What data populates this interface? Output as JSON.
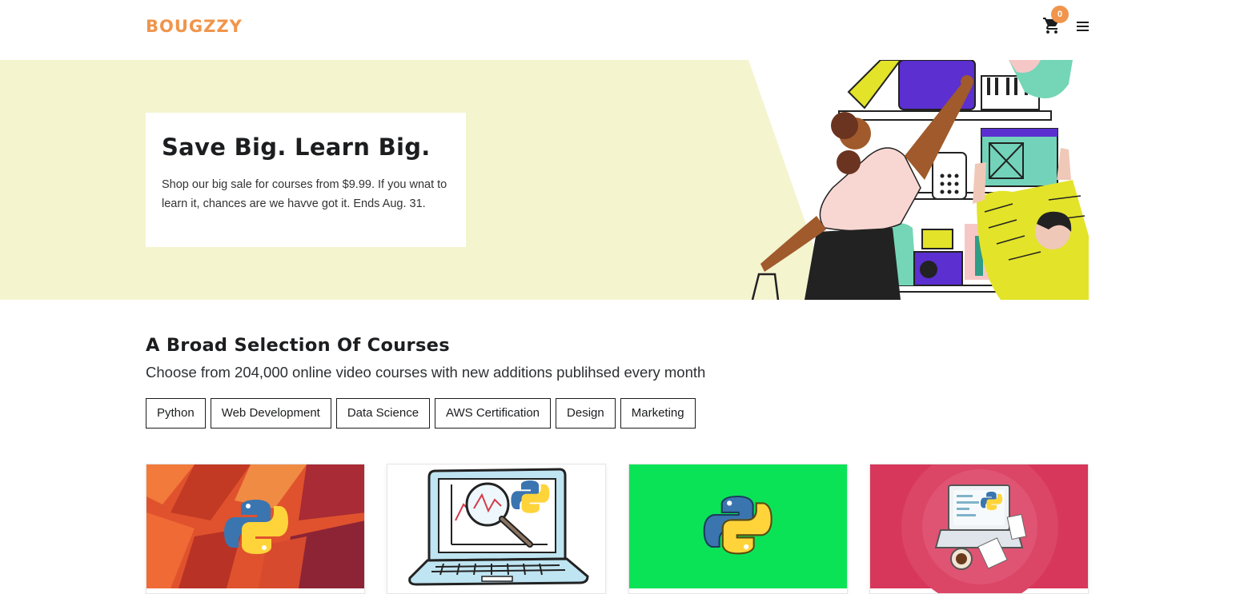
{
  "header": {
    "brand": "BOUGZZY",
    "cart_count": "0",
    "icons": [
      "cart-icon",
      "menu-icon"
    ]
  },
  "hero": {
    "title": "Save Big. Learn Big.",
    "text": "Shop our big sale for courses from $9.99. If you wnat to learn it, chances are we havve got it. Ends Aug. 31."
  },
  "section": {
    "title": "A Broad Selection Of Courses",
    "subtitle": "Choose from 204,000 online video courses with new additions publihsed every month",
    "tags": [
      "Python",
      "Web Development",
      "Data Science",
      "AWS Certification",
      "Design",
      "Marketing"
    ]
  },
  "colors": {
    "accent": "#f0954b",
    "hero_bg": "#f4f4cf",
    "card1_bg": "#e0522d",
    "card3_bg": "#0be357",
    "card4_bg": "#d7375a"
  }
}
